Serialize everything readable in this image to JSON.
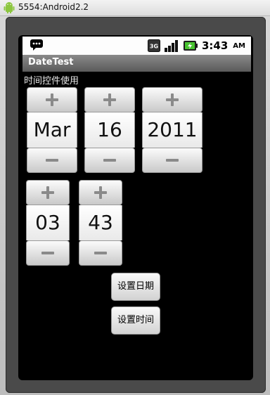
{
  "window": {
    "title": "5554:Android2.2"
  },
  "statusbar": {
    "network_badge": "3G",
    "time": "3:43",
    "ampm": "AM"
  },
  "app": {
    "title": "DateTest",
    "label": "时间控件使用"
  },
  "date_picker": {
    "month": "Mar",
    "day": "16",
    "year": "2011"
  },
  "time_picker": {
    "hour": "03",
    "minute": "43"
  },
  "buttons": {
    "set_date": "设置日期",
    "set_time": "设置时间"
  },
  "icons": {
    "window": "android-robot-icon",
    "notification": "chat-bubble-icon",
    "network": "3g-icon",
    "signal": "signal-bars-icon",
    "battery": "battery-charging-icon",
    "increment": "plus-icon",
    "decrement": "minus-icon"
  }
}
